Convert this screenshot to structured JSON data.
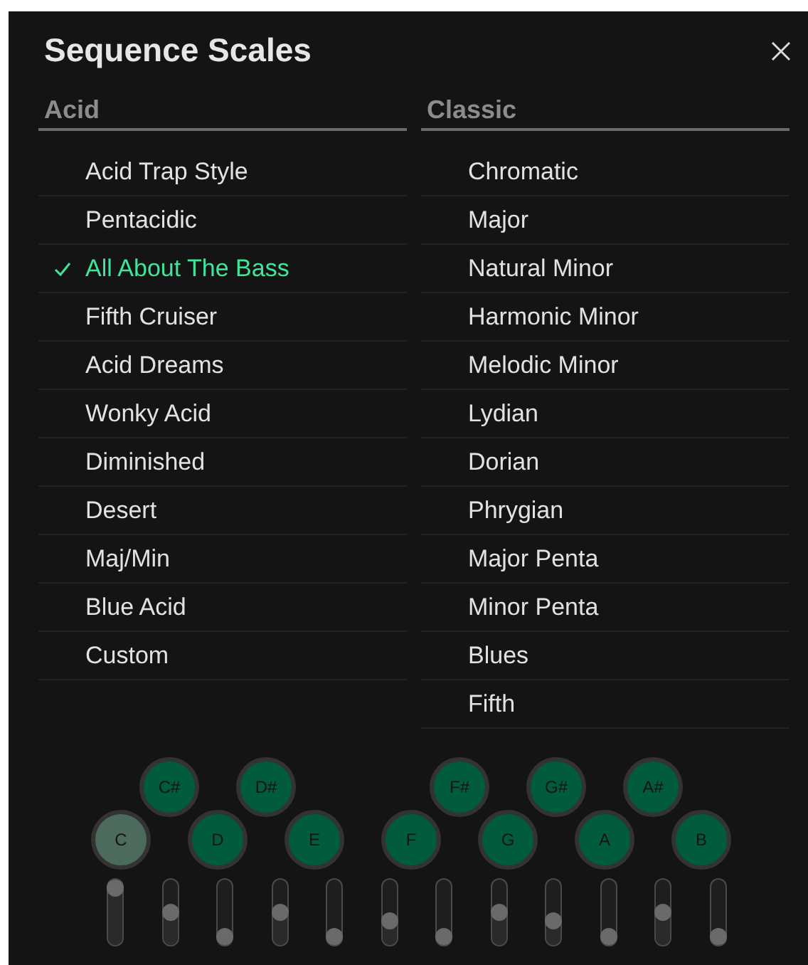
{
  "title": "Sequence Scales",
  "columns": [
    {
      "heading": "Acid",
      "items": [
        {
          "label": "Acid Trap Style",
          "selected": false
        },
        {
          "label": "Pentacidic",
          "selected": false
        },
        {
          "label": "All About The Bass",
          "selected": true
        },
        {
          "label": "Fifth Cruiser",
          "selected": false
        },
        {
          "label": "Acid Dreams",
          "selected": false
        },
        {
          "label": "Wonky Acid",
          "selected": false
        },
        {
          "label": "Diminished",
          "selected": false
        },
        {
          "label": "Desert",
          "selected": false
        },
        {
          "label": "Maj/Min",
          "selected": false
        },
        {
          "label": "Blue Acid",
          "selected": false
        },
        {
          "label": "Custom",
          "selected": false
        }
      ]
    },
    {
      "heading": "Classic",
      "items": [
        {
          "label": "Chromatic",
          "selected": false
        },
        {
          "label": "Major",
          "selected": false
        },
        {
          "label": "Natural Minor",
          "selected": false
        },
        {
          "label": "Harmonic Minor",
          "selected": false
        },
        {
          "label": "Melodic Minor",
          "selected": false
        },
        {
          "label": "Lydian",
          "selected": false
        },
        {
          "label": "Dorian",
          "selected": false
        },
        {
          "label": "Phrygian",
          "selected": false
        },
        {
          "label": "Major Penta",
          "selected": false
        },
        {
          "label": "Minor Penta",
          "selected": false
        },
        {
          "label": "Blues",
          "selected": false
        },
        {
          "label": "Fifth",
          "selected": false
        }
      ]
    }
  ],
  "notes": [
    {
      "label": "C",
      "kind": "white",
      "selected": true
    },
    {
      "label": "C#",
      "kind": "black",
      "selected": false
    },
    {
      "label": "D",
      "kind": "white",
      "selected": false
    },
    {
      "label": "D#",
      "kind": "black",
      "selected": false
    },
    {
      "label": "E",
      "kind": "white",
      "selected": false
    },
    {
      "label": "F",
      "kind": "white",
      "selected": false
    },
    {
      "label": "F#",
      "kind": "black",
      "selected": false
    },
    {
      "label": "G",
      "kind": "white",
      "selected": false
    },
    {
      "label": "G#",
      "kind": "black",
      "selected": false
    },
    {
      "label": "A",
      "kind": "white",
      "selected": false
    },
    {
      "label": "A#",
      "kind": "black",
      "selected": false
    },
    {
      "label": "B",
      "kind": "white",
      "selected": false
    }
  ],
  "sliders": [
    {
      "level": 1
    },
    {
      "level": 0.5
    },
    {
      "level": 0
    },
    {
      "level": 0.5
    },
    {
      "level": 0
    },
    {
      "level": 0.33
    },
    {
      "level": 0
    },
    {
      "level": 0.5
    },
    {
      "level": 0.33
    },
    {
      "level": 0
    },
    {
      "level": 0.5
    },
    {
      "level": 0
    }
  ]
}
